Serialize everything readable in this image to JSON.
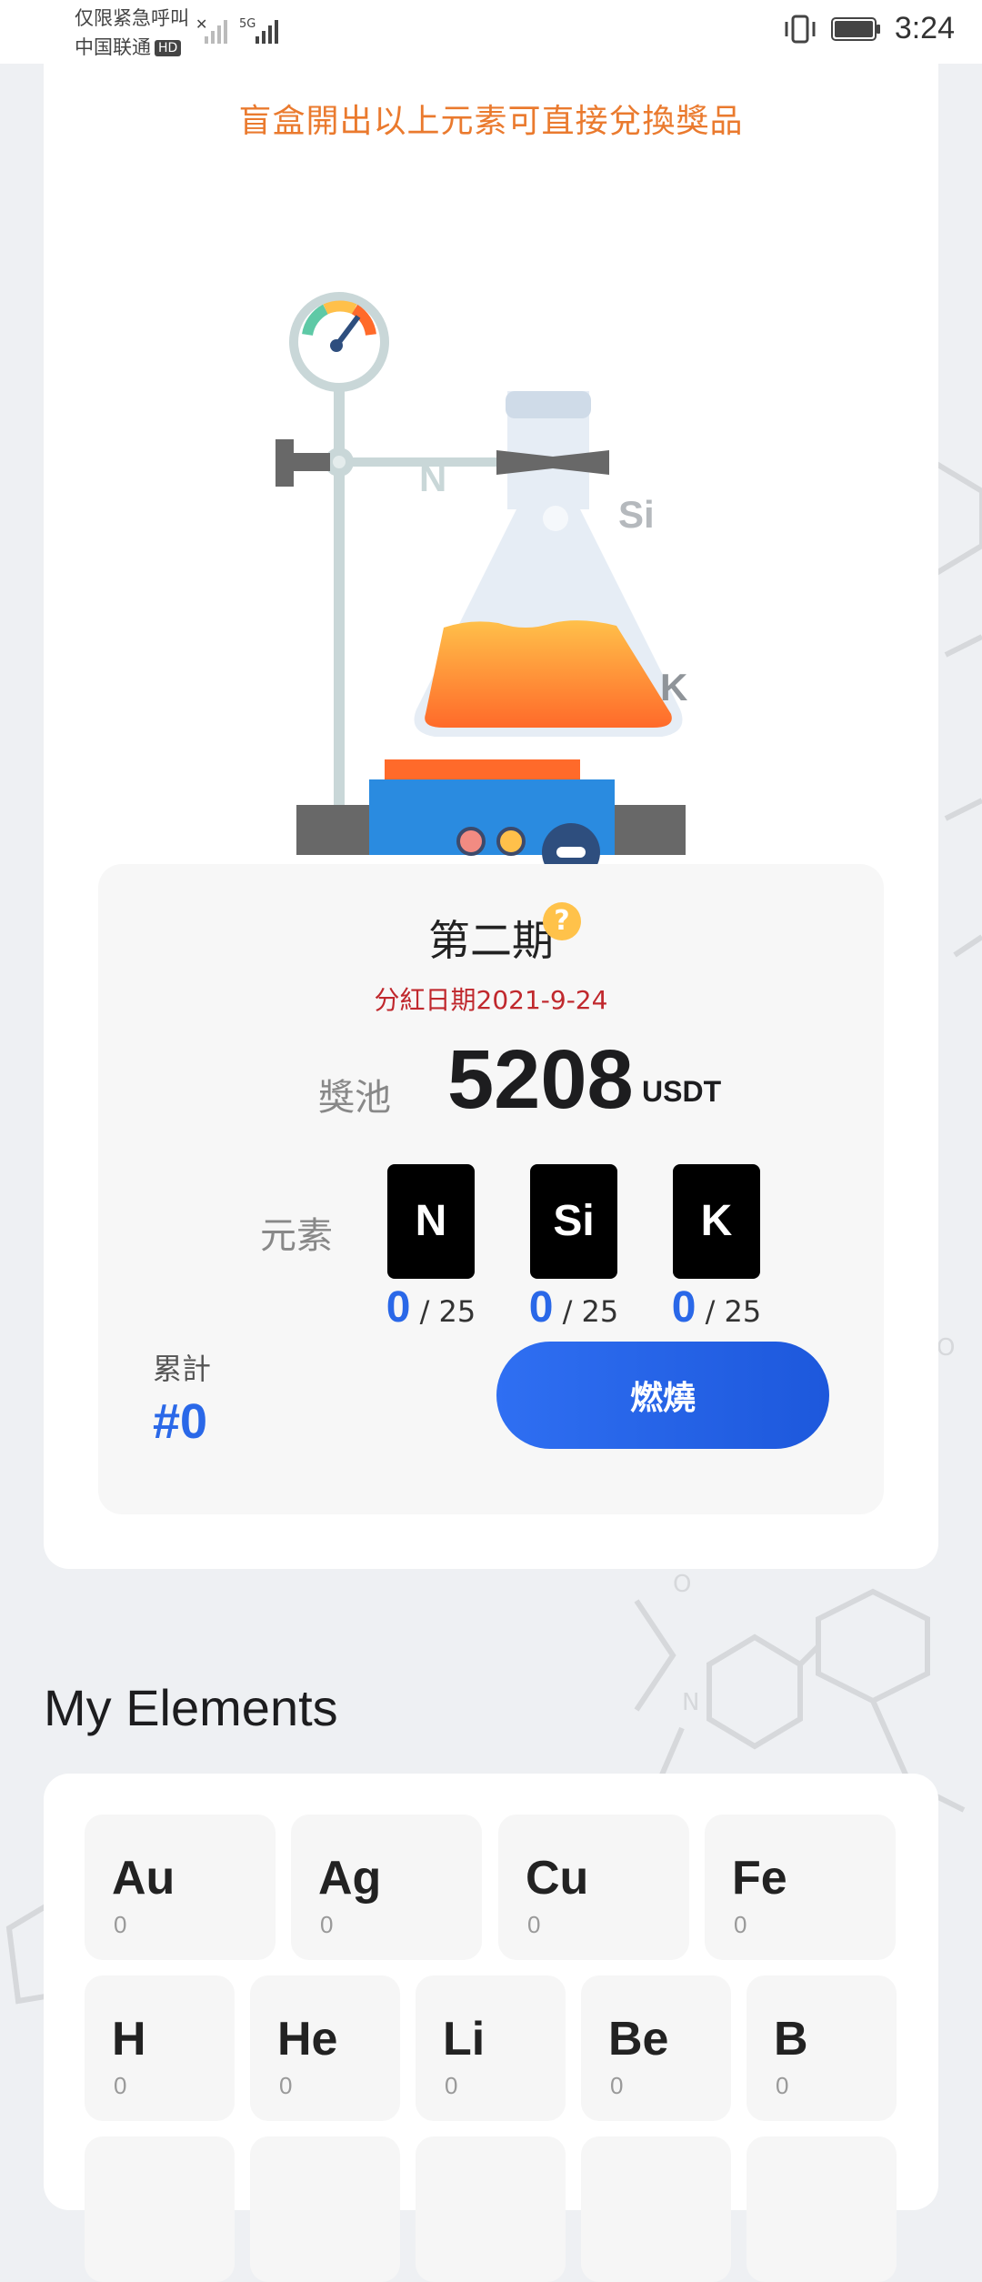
{
  "status_bar": {
    "line1": "仅限紧急呼叫",
    "line2": "中国联通",
    "hd_badge": "HD",
    "network": "5G",
    "time": "3:24"
  },
  "banner": {
    "text": "盲盒開出以上元素可直接兌換獎品"
  },
  "illustration": {
    "labels": [
      "N",
      "Si",
      "K"
    ]
  },
  "period": {
    "title": "第二期",
    "help": "?",
    "dividend_date": "分紅日期2021-9-24",
    "pool_label": "獎池",
    "pool_value": "5208",
    "pool_unit": "USDT",
    "elements_label": "元素",
    "elements": [
      {
        "symbol": "N",
        "current": "0",
        "total": "/ 25"
      },
      {
        "symbol": "Si",
        "current": "0",
        "total": "/ 25"
      },
      {
        "symbol": "K",
        "current": "0",
        "total": "/ 25"
      }
    ],
    "cumulative_label": "累計",
    "cumulative_value": "#0",
    "burn_button": "燃燒"
  },
  "my_elements": {
    "title": "My Elements",
    "row1": [
      {
        "symbol": "Au",
        "count": "0"
      },
      {
        "symbol": "Ag",
        "count": "0"
      },
      {
        "symbol": "Cu",
        "count": "0"
      },
      {
        "symbol": "Fe",
        "count": "0"
      }
    ],
    "row2": [
      {
        "symbol": "H",
        "count": "0"
      },
      {
        "symbol": "He",
        "count": "0"
      },
      {
        "symbol": "Li",
        "count": "0"
      },
      {
        "symbol": "Be",
        "count": "0"
      },
      {
        "symbol": "B",
        "count": "0"
      }
    ]
  },
  "colors": {
    "accent_blue": "#2a68e8",
    "banner_orange": "#ea7a2e",
    "dividend_red": "#c0282d"
  }
}
